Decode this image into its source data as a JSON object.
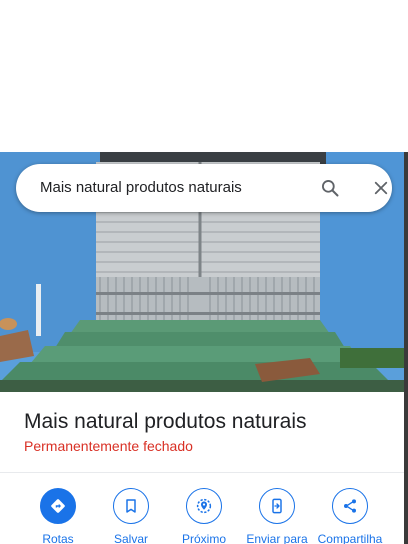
{
  "search": {
    "query": "Mais natural produtos naturais"
  },
  "place": {
    "title": "Mais natural produtos naturais",
    "status": "Permanentemente fechado"
  },
  "actions": [
    {
      "label": "Rotas",
      "icon": "directions-icon"
    },
    {
      "label": "Salvar",
      "icon": "bookmark-icon"
    },
    {
      "label": "Próximo",
      "icon": "nearby-icon"
    },
    {
      "label": "Enviar para",
      "icon": "send-to-phone-icon"
    },
    {
      "label": "Compartilha",
      "icon": "share-icon"
    }
  ],
  "colors": {
    "accent": "#1a73e8",
    "status_closed": "#d93025",
    "wall": "#5aa0dc"
  }
}
